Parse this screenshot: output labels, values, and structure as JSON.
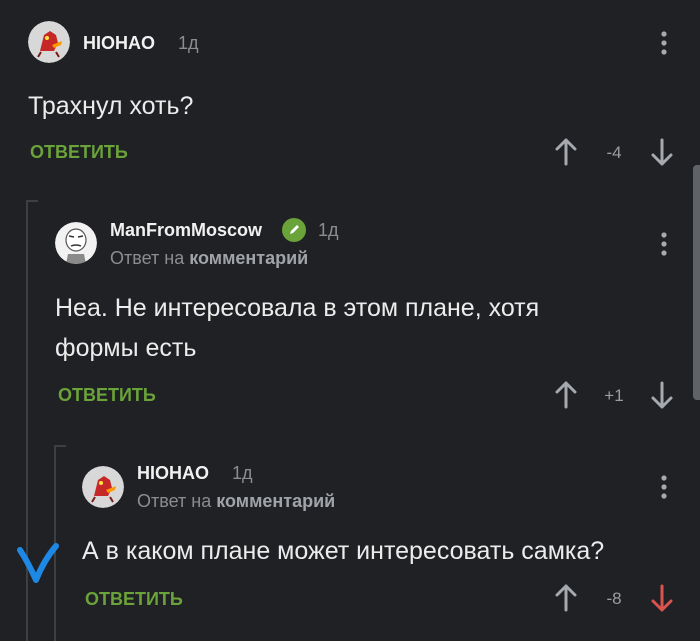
{
  "comments": [
    {
      "username": "HIOHAO",
      "time": "1д",
      "text": "Трахнул хоть?",
      "reply_label": "ОТВЕТИТЬ",
      "score": "-4"
    },
    {
      "username": "ManFromMoscow",
      "time": "1д",
      "reply_prefix": "Ответ на",
      "reply_link": "комментарий",
      "text_line1": "Неа. Не интересовала в этом плане, хотя",
      "text_line2": "формы есть",
      "reply_label": "ОТВЕТИТЬ",
      "score": "+1"
    },
    {
      "username": "HIOHAO",
      "time": "1д",
      "reply_prefix": "Ответ на",
      "reply_link": "комментарий",
      "text": "А в каком плане может интересовать самка?",
      "reply_label": "ОТВЕТИТЬ",
      "score": "-8"
    }
  ],
  "colors": {
    "background": "#202124",
    "accent_green": "#6aa339",
    "downvote_active": "#d9534f",
    "check_mark": "#1e88e5"
  },
  "icons": {
    "upvote": "arrow-up-icon",
    "downvote": "arrow-down-icon",
    "menu": "more-vertical-icon",
    "verified": "pencil-badge-icon",
    "check": "check-mark-icon"
  }
}
